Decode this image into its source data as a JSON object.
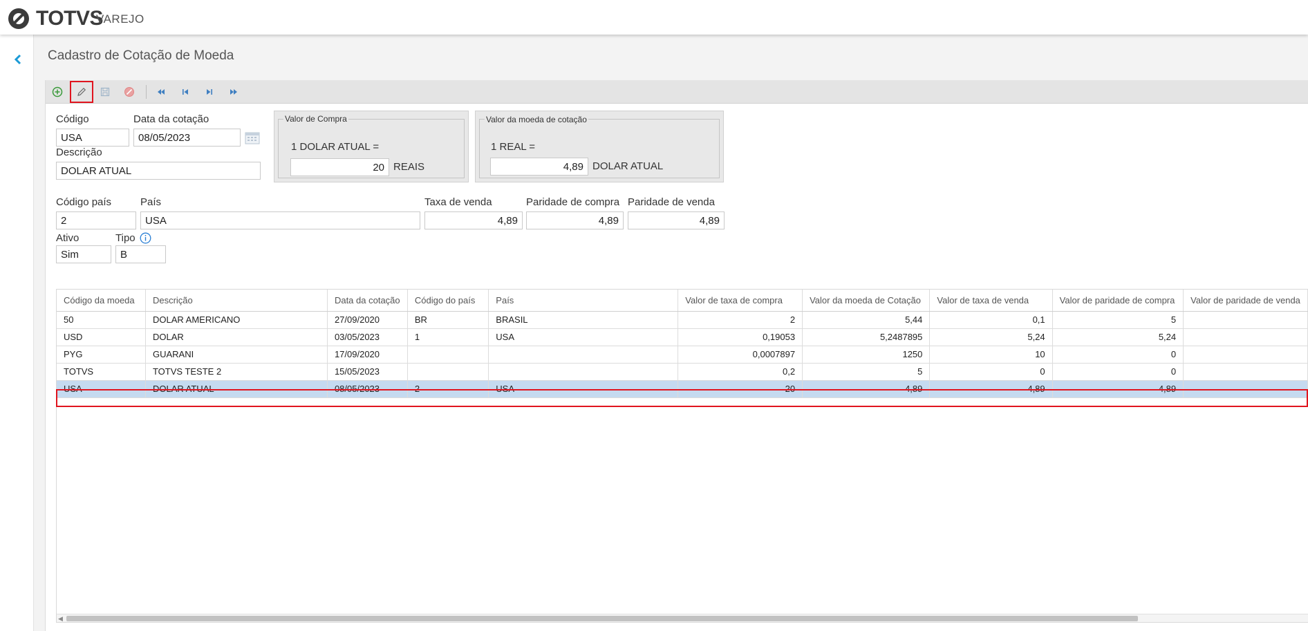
{
  "brand": {
    "name": "TOTVS",
    "product": "VAREJO",
    "logo_icon": "totvs-logo-icon"
  },
  "page_title": "Cadastro de Cotação de Moeda",
  "toolbar": {
    "buttons": [
      "add-icon",
      "edit-icon",
      "save-icon",
      "cancel-icon",
      "first-record-icon",
      "previous-record-icon",
      "next-record-icon",
      "last-record-icon"
    ]
  },
  "form": {
    "codigo_label": "Código",
    "codigo_value": "USA",
    "data_label": "Data da cotação",
    "data_value": "08/05/2023",
    "descricao_label": "Descrição",
    "descricao_value": "DOLAR ATUAL",
    "compra": {
      "title": "Valor de Compra",
      "line": "1 DOLAR ATUAL =",
      "value": "20",
      "unit": "REAIS"
    },
    "moeda": {
      "title": "Valor da moeda de cotação",
      "line": "1 REAL =",
      "value": "4,89",
      "unit": "DOLAR ATUAL"
    },
    "codigo_pais_label": "Código país",
    "codigo_pais_value": "2",
    "pais_label": "País",
    "pais_value": "USA",
    "taxa_venda_label": "Taxa de venda",
    "taxa_venda_value": "4,89",
    "paridade_compra_label": "Paridade de compra",
    "paridade_compra_value": "4,89",
    "paridade_venda_label": "Paridade de venda",
    "paridade_venda_value": "4,89",
    "ativo_label": "Ativo",
    "ativo_value": "Sim",
    "tipo_label": "Tipo",
    "tipo_value": "B"
  },
  "grid": {
    "columns": [
      "Código da moeda",
      "Descrição",
      "Data da cotação",
      "Código do país",
      "País",
      "Valor de taxa de compra",
      "Valor da moeda de Cotação",
      "Valor de taxa de venda",
      "Valor de paridade de compra",
      "Valor de paridade de venda"
    ],
    "rows": [
      [
        "50",
        "DOLAR AMERICANO",
        "27/09/2020",
        "BR",
        "BRASIL",
        "2",
        "5,44",
        "0,1",
        "5",
        ""
      ],
      [
        "USD",
        "DOLAR",
        "03/05/2023",
        "1",
        "USA",
        "0,19053",
        "5,2487895",
        "5,24",
        "5,24",
        ""
      ],
      [
        "PYG",
        "GUARANI",
        "17/09/2020",
        "",
        "",
        "0,0007897",
        "1250",
        "10",
        "0",
        ""
      ],
      [
        "TOTVS",
        "TOTVS TESTE 2",
        "15/05/2023",
        "",
        "",
        "0,2",
        "5",
        "0",
        "0",
        ""
      ],
      [
        "USA",
        "DOLAR ATUAL",
        "08/05/2023",
        "2",
        "USA",
        "20",
        "4,89",
        "4,89",
        "4,89",
        ""
      ]
    ],
    "selected_row": 4
  }
}
